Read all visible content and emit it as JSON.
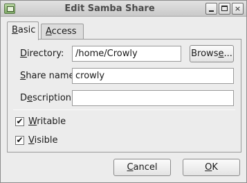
{
  "window": {
    "title": "Edit Samba Share",
    "minimize_glyph": "",
    "maximize_glyph": "",
    "close_glyph": "×"
  },
  "tabs": [
    {
      "label_first": "B",
      "label_rest": "asic",
      "active": true
    },
    {
      "label_first": "A",
      "label_rest": "ccess",
      "active": false
    }
  ],
  "form": {
    "directory": {
      "label_first": "D",
      "label_rest": "irectory:",
      "value": "/home/Crowly"
    },
    "browse_button": {
      "label_pre": "Brows",
      "label_u": "e",
      "label_post": "..."
    },
    "share_name": {
      "label_first": "S",
      "label_rest": "hare name:",
      "value": "crowly"
    },
    "description": {
      "label_pre": "D",
      "label_u": "e",
      "label_post": "scription:",
      "value": ""
    },
    "writable": {
      "label_first": "W",
      "label_rest": "ritable",
      "checked": true,
      "check_glyph": "✔"
    },
    "visible": {
      "label_first": "V",
      "label_rest": "isible",
      "checked": true,
      "check_glyph": "✔"
    }
  },
  "footer": {
    "cancel": {
      "label_first": "C",
      "label_rest": "ancel"
    },
    "ok": {
      "label_first": "O",
      "label_rest": "K"
    }
  },
  "icons": {
    "app": "samba-share-icon",
    "minimize": "minimize-icon",
    "maximize": "maximize-icon",
    "close": "close-icon"
  }
}
